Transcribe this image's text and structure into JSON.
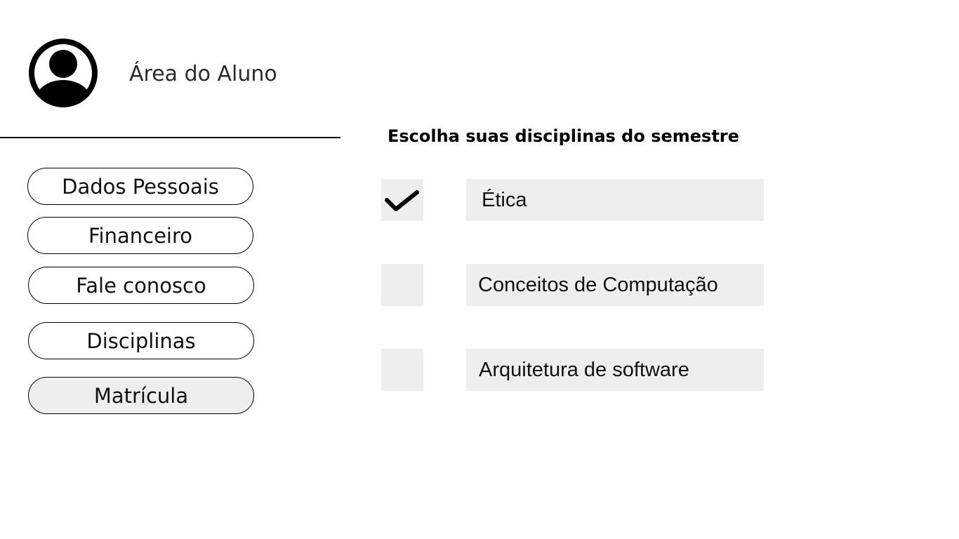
{
  "header": {
    "avatar_icon": "user-circle-icon",
    "title": "Área do Aluno"
  },
  "nav": {
    "items": [
      {
        "label": "Dados Pessoais",
        "active": false
      },
      {
        "label": "Financeiro",
        "active": false
      },
      {
        "label": "Fale conosco",
        "active": false
      },
      {
        "label": "Disciplinas",
        "active": false
      },
      {
        "label": "Matrícula",
        "active": true
      }
    ]
  },
  "enrollment": {
    "title": "Escolha suas disciplinas do semestre",
    "courses": [
      {
        "name": "Ética",
        "checked": true
      },
      {
        "name": "Conceitos de Computação",
        "checked": false
      },
      {
        "name": "Arquitetura de software",
        "checked": false
      }
    ]
  },
  "colors": {
    "box_fill": "#eeeeee",
    "outline": "#000000",
    "active_button_fill": "#eeeeee"
  },
  "icons": {
    "check": "check-icon"
  }
}
